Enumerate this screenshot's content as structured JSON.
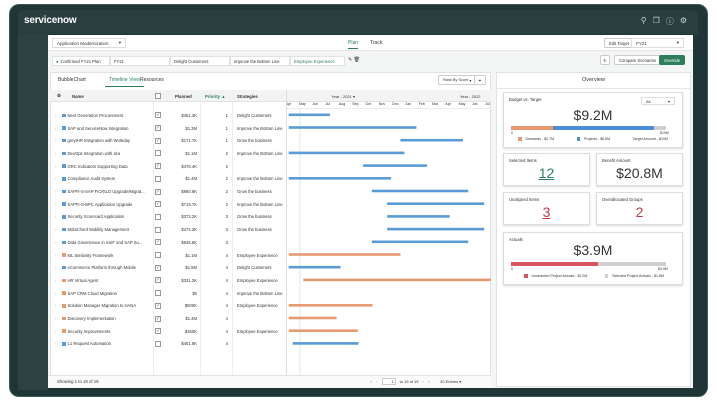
{
  "header": {
    "logo": "servicenow",
    "icons": [
      "search-icon",
      "chat-icon",
      "help-icon",
      "gear-icon"
    ]
  },
  "toolbar": {
    "portfolio": "Application Modernization",
    "tabs": [
      "Plan",
      "Track"
    ],
    "active_tab": "Plan",
    "edit_target_label": "Edit Target",
    "edit_target_value": "FY21",
    "compare_label": "Compare Scenarios",
    "override_label": "Override"
  },
  "filters": {
    "plan": "Confirmed FY21 Plan",
    "year": "FY21",
    "chips": [
      "Delight Customers",
      "Improve the Bottom Line",
      "Employee Experience"
    ]
  },
  "view_tabs": [
    "BubbleChart",
    "Timeline View",
    "Resources"
  ],
  "active_view": "Timeline View",
  "rank_by": "Rank By Score",
  "table": {
    "columns": [
      "Name",
      "Planned",
      "Priority ▲",
      "Strategies"
    ],
    "rows": [
      {
        "name": "Next Generation Procurement",
        "type": "project",
        "checked": true,
        "planned": "$451.3K",
        "priority": "1",
        "strategy": "Delight Customers"
      },
      {
        "name": "SAP and ServiceNow Integration",
        "type": "project",
        "checked": true,
        "planned": "$1.3M",
        "priority": "1",
        "strategy": "Improve the Bottom Line"
      },
      {
        "name": "greytHR Integration with Workday",
        "type": "project",
        "checked": true,
        "planned": "$171.7K",
        "priority": "1",
        "strategy": "Grow the business"
      },
      {
        "name": "DevOps Integration with Jira",
        "type": "project",
        "checked": false,
        "planned": "$1.1M",
        "priority": "2",
        "strategy": "Improve the Bottom Line"
      },
      {
        "name": "GRC Indicators Supporting Data",
        "type": "project",
        "checked": true,
        "planned": "$476.4K",
        "priority": "2",
        "strategy": ""
      },
      {
        "name": "Compliance Audit System",
        "type": "project",
        "checked": false,
        "planned": "$1.4M",
        "priority": "2",
        "strategy": "Improve the Bottom Line"
      },
      {
        "name": "SAPFI-S-SAP FIO/SLO Upgrade/Migrat...",
        "type": "project",
        "checked": true,
        "planned": "$960.6K",
        "priority": "2",
        "strategy": "Grow the business"
      },
      {
        "name": "SAPFI-S-BPC Application Upgrade",
        "type": "project",
        "checked": true,
        "planned": "$719.7K",
        "priority": "2",
        "strategy": "Improve the Bottom Line"
      },
      {
        "name": "Security Scorecard Application",
        "type": "project",
        "checked": false,
        "planned": "$373.2K",
        "priority": "3",
        "strategy": "Grow the business"
      },
      {
        "name": "MobiChord Mobility Management",
        "type": "project",
        "checked": false,
        "planned": "$472.3K",
        "priority": "3",
        "strategy": "Grow the business"
      },
      {
        "name": "Data Governance in SorF and SAP Su...",
        "type": "project",
        "checked": true,
        "planned": "$835.8K",
        "priority": "3",
        "strategy": ""
      },
      {
        "name": "ML Similarity Framework",
        "type": "demand",
        "checked": false,
        "planned": "$1.1M",
        "priority": "4",
        "strategy": "Employee Experience"
      },
      {
        "name": "eCommerce Platform through Mobile",
        "type": "project",
        "checked": true,
        "planned": "$1.5M",
        "priority": "4",
        "strategy": "Delight Customers"
      },
      {
        "name": "HR Virtual Agent",
        "type": "demand",
        "checked": true,
        "planned": "$331.3K",
        "priority": "4",
        "strategy": "Employee Experience"
      },
      {
        "name": "SAP CRM Cloud Migration",
        "type": "demand",
        "checked": false,
        "planned": "$0",
        "priority": "4",
        "strategy": "Improve the Bottom Line"
      },
      {
        "name": "Solution Manager Migration to HANA",
        "type": "demand",
        "checked": true,
        "planned": "$500K",
        "priority": "4",
        "strategy": "Employee Experience"
      },
      {
        "name": "Discovery Implementation",
        "type": "demand",
        "checked": true,
        "planned": "$1.4M",
        "priority": "4",
        "strategy": ""
      },
      {
        "name": "Security Improvements",
        "type": "demand",
        "checked": true,
        "planned": "$450K",
        "priority": "4",
        "strategy": "Employee Experience"
      },
      {
        "name": "L1 Request Automation",
        "type": "project",
        "checked": false,
        "planned": "$401.8K",
        "priority": "4",
        "strategy": ""
      }
    ],
    "footer": "Showing 1 to 19 of 19",
    "page_input": "1",
    "page_text": "to 19 of 19",
    "entries": "20 Entries"
  },
  "gantt": {
    "year_left": "Year - 2021 ▾",
    "year_right": "Year - 2022",
    "months": [
      "Apr",
      "May",
      "Jun",
      "Jul",
      "Aug",
      "Sep",
      "Oct",
      "Nov",
      "Dec",
      "Jan",
      "Feb",
      "Mar",
      "Apr",
      "May",
      "Jun",
      "Jul"
    ],
    "today_month": 0.8,
    "bars": [
      [
        0,
        3.1
      ],
      [
        0,
        9.6
      ],
      [
        8.4,
        13.1
      ],
      [
        0,
        8.7
      ],
      [
        5.6,
        10.4
      ],
      [
        0,
        7.7
      ],
      [
        6.25,
        13.5
      ],
      [
        7.4,
        14.7
      ],
      [
        7.4,
        12.1
      ],
      [
        7.4,
        14.7
      ],
      [
        6.25,
        13.5
      ],
      [
        0,
        8.4
      ],
      [
        0,
        3.9
      ],
      [
        1.1,
        15.2
      ],
      null,
      [
        0,
        6.3
      ],
      [
        0,
        3.6
      ],
      [
        0,
        5.2
      ],
      [
        0.3,
        5.25
      ]
    ]
  },
  "colors": {
    "project": "#5b9bd5",
    "demand": "#e59a72",
    "accent": "#2e7d5b",
    "alert": "#c83a4a",
    "grey": "#cfcfcf"
  },
  "overview": {
    "title": "Overview",
    "budget": {
      "title": "Budget vs. Target",
      "filter": "All",
      "value": "$9.2M",
      "demands_pct": 27,
      "projects_pct": 65,
      "axis_min": "0",
      "axis_max": "$10M",
      "legend": [
        "Demands - $2.7M",
        "Projects - $6.5M",
        "Target Amount - $10M"
      ]
    },
    "selected_items": {
      "title": "Selected Items",
      "value": "12"
    },
    "benefit": {
      "title": "Benefit Amount",
      "value": "$20.8M"
    },
    "unaligned": {
      "title": "Unaligned Items",
      "value": "3"
    },
    "overallocated": {
      "title": "Overallocated Groups",
      "value": "2"
    },
    "actuals": {
      "title": "Actuals",
      "value": "$3.9M",
      "unselected_pct": 56,
      "axis_min": "0",
      "axis_max": "$3.9M",
      "legend": [
        "Unselected Project Actuals - $2.2M",
        "Selected Project Actuals - $1.8M"
      ]
    }
  }
}
